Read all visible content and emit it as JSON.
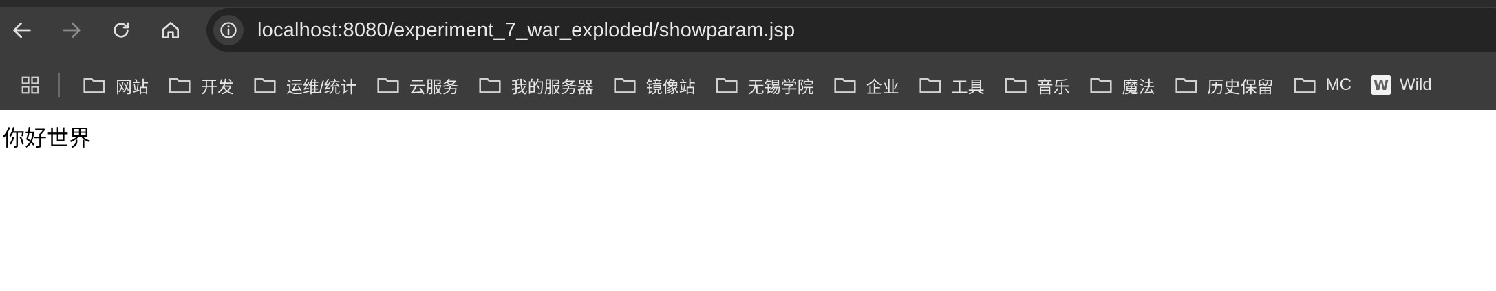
{
  "browser": {
    "url": "localhost:8080/experiment_7_war_exploded/showparam.jsp",
    "nav_icons": [
      "back-arrow-icon",
      "forward-arrow-icon",
      "reload-icon",
      "home-icon",
      "info-icon"
    ]
  },
  "bookmarks": {
    "apps_icon": "apps-grid-icon",
    "items": [
      {
        "label": "网站",
        "icon": "folder-icon"
      },
      {
        "label": "开发",
        "icon": "folder-icon"
      },
      {
        "label": "运维/统计",
        "icon": "folder-icon"
      },
      {
        "label": "云服务",
        "icon": "folder-icon"
      },
      {
        "label": "我的服务器",
        "icon": "folder-icon"
      },
      {
        "label": "镜像站",
        "icon": "folder-icon"
      },
      {
        "label": "无锡学院",
        "icon": "folder-icon"
      },
      {
        "label": "企业",
        "icon": "folder-icon"
      },
      {
        "label": "工具",
        "icon": "folder-icon"
      },
      {
        "label": "音乐",
        "icon": "folder-icon"
      },
      {
        "label": "魔法",
        "icon": "folder-icon"
      },
      {
        "label": "历史保留",
        "icon": "folder-icon"
      },
      {
        "label": "MC",
        "icon": "folder-icon"
      },
      {
        "label": "Wild",
        "icon": "w-favicon",
        "favicon_letter": "W"
      }
    ]
  },
  "page": {
    "body_text": "你好世界"
  },
  "colors": {
    "toolbar_bg": "#3c3c3c",
    "omnibox_bg": "#242424",
    "text_light": "#e8e8e8",
    "page_bg": "#ffffff"
  }
}
